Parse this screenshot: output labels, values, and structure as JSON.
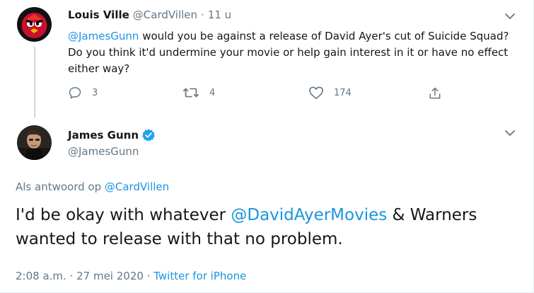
{
  "tweet_parent": {
    "author_name": "Louis Ville",
    "handle": "@CardVillen",
    "separator": "·",
    "time_ago": "11 u",
    "mention": "@JamesGunn",
    "text": " would you be against a release of David Ayer's cut of Suicide Squad? Do you think it'd undermine your movie or help gain interest in it or have no effect either way?",
    "reply_count": "3",
    "retweet_count": "4",
    "like_count": "174",
    "avatar_color": "#c8102e"
  },
  "tweet_main": {
    "author_name": "James Gunn",
    "handle": "@JamesGunn",
    "verified_color": "#1da1f2",
    "replying_prefix": "Als antwoord op ",
    "replying_to": "@CardVillen",
    "text_before": "I'd be okay with whatever ",
    "text_mention": "@DavidAyerMovies",
    "text_after": " & Warners wanted to release with that no problem.",
    "time": "2:08 a.m.",
    "date_sep": " · ",
    "date": "27 mei 2020",
    "source_sep": " · ",
    "source": "Twitter for iPhone"
  },
  "colors": {
    "link": "#1b95e0",
    "secondary_text": "#657786",
    "primary_text": "#14171a"
  }
}
